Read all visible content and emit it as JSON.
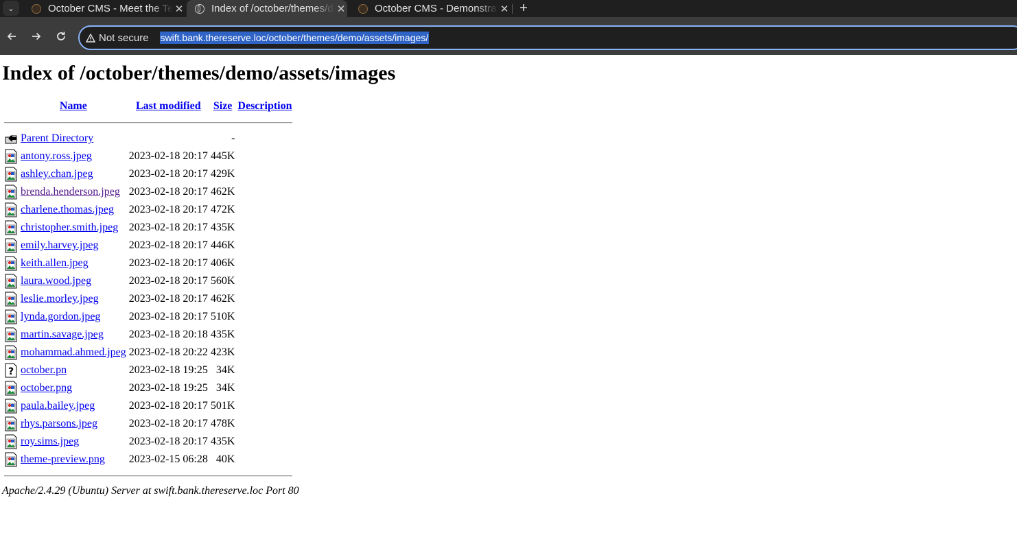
{
  "browser": {
    "tabs": [
      {
        "title": "October CMS - Meet the Team",
        "active": false
      },
      {
        "title": "Index of /october/themes/demo/assets/images",
        "active": true
      },
      {
        "title": "October CMS - Demonstration",
        "active": false
      }
    ],
    "security_label": "Not secure",
    "url": "swift.bank.thereserve.loc/october/themes/demo/assets/images/"
  },
  "page": {
    "heading": "Index of /october/themes/demo/assets/images",
    "columns": {
      "name": "Name",
      "last_modified": "Last modified",
      "size": "Size",
      "description": "Description"
    },
    "parent": {
      "name": "Parent Directory",
      "size": "-"
    },
    "files": [
      {
        "name": "antony.ross.jpeg",
        "modified": "2023-02-18 20:17",
        "size": "445K",
        "icon": "image-icon"
      },
      {
        "name": "ashley.chan.jpeg",
        "modified": "2023-02-18 20:17",
        "size": "429K",
        "icon": "image-icon"
      },
      {
        "name": "brenda.henderson.jpeg",
        "modified": "2023-02-18 20:17",
        "size": "462K",
        "icon": "image-icon",
        "visited": true
      },
      {
        "name": "charlene.thomas.jpeg",
        "modified": "2023-02-18 20:17",
        "size": "472K",
        "icon": "image-icon"
      },
      {
        "name": "christopher.smith.jpeg",
        "modified": "2023-02-18 20:17",
        "size": "435K",
        "icon": "image-icon"
      },
      {
        "name": "emily.harvey.jpeg",
        "modified": "2023-02-18 20:17",
        "size": "446K",
        "icon": "image-icon"
      },
      {
        "name": "keith.allen.jpeg",
        "modified": "2023-02-18 20:17",
        "size": "406K",
        "icon": "image-icon"
      },
      {
        "name": "laura.wood.jpeg",
        "modified": "2023-02-18 20:17",
        "size": "560K",
        "icon": "image-icon"
      },
      {
        "name": "leslie.morley.jpeg",
        "modified": "2023-02-18 20:17",
        "size": "462K",
        "icon": "image-icon"
      },
      {
        "name": "lynda.gordon.jpeg",
        "modified": "2023-02-18 20:17",
        "size": "510K",
        "icon": "image-icon"
      },
      {
        "name": "martin.savage.jpeg",
        "modified": "2023-02-18 20:18",
        "size": "435K",
        "icon": "image-icon"
      },
      {
        "name": "mohammad.ahmed.jpeg",
        "modified": "2023-02-18 20:22",
        "size": "423K",
        "icon": "image-icon"
      },
      {
        "name": "october.pn",
        "modified": "2023-02-18 19:25",
        "size": "34K",
        "icon": "unknown-file-icon"
      },
      {
        "name": "october.png",
        "modified": "2023-02-18 19:25",
        "size": "34K",
        "icon": "image-icon"
      },
      {
        "name": "paula.bailey.jpeg",
        "modified": "2023-02-18 20:17",
        "size": "501K",
        "icon": "image-icon"
      },
      {
        "name": "rhys.parsons.jpeg",
        "modified": "2023-02-18 20:17",
        "size": "478K",
        "icon": "image-icon"
      },
      {
        "name": "roy.sims.jpeg",
        "modified": "2023-02-18 20:17",
        "size": "435K",
        "icon": "image-icon"
      },
      {
        "name": "theme-preview.png",
        "modified": "2023-02-15 06:28",
        "size": "40K",
        "icon": "image-icon"
      }
    ],
    "footer": "Apache/2.4.29 (Ubuntu) Server at swift.bank.thereserve.loc Port 80"
  }
}
